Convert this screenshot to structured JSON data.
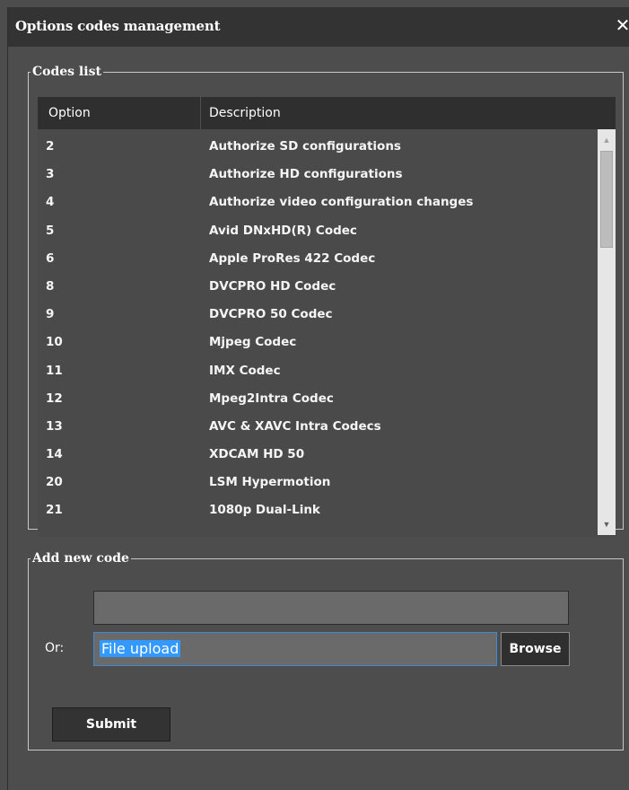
{
  "dialog": {
    "title": "Options codes management",
    "close_glyph": "✕"
  },
  "codes_list": {
    "legend": "Codes list",
    "columns": [
      "Option",
      "Description"
    ],
    "rows": [
      {
        "option": "2",
        "description": "Authorize SD configurations"
      },
      {
        "option": "3",
        "description": "Authorize HD configurations"
      },
      {
        "option": "4",
        "description": "Authorize video configuration changes"
      },
      {
        "option": "5",
        "description": "Avid DNxHD(R) Codec"
      },
      {
        "option": "6",
        "description": "Apple ProRes 422 Codec"
      },
      {
        "option": "8",
        "description": "DVCPRO HD Codec"
      },
      {
        "option": "9",
        "description": "DVCPRO 50 Codec"
      },
      {
        "option": "10",
        "description": "Mjpeg Codec"
      },
      {
        "option": "11",
        "description": "IMX Codec"
      },
      {
        "option": "12",
        "description": "Mpeg2Intra Codec"
      },
      {
        "option": "13",
        "description": "AVC & XAVC Intra Codecs"
      },
      {
        "option": "14",
        "description": "XDCAM HD 50"
      },
      {
        "option": "20",
        "description": "LSM Hypermotion"
      },
      {
        "option": "21",
        "description": "1080p Dual-Link"
      }
    ],
    "scroll_up_glyph": "▲",
    "scroll_down_glyph": "▼"
  },
  "add_code": {
    "legend": "Add new code",
    "code_value": "",
    "or_label": "Or:",
    "file_value": "File upload",
    "browse_label": "Browse",
    "submit_label": "Submit"
  },
  "colors": {
    "background": "#4d4d4d",
    "titlebar": "#333333",
    "header": "#2f2f2f",
    "selection": "#3399ff"
  },
  "icons": [
    "close-icon",
    "scroll-up-arrow-icon",
    "scroll-down-arrow-icon"
  ]
}
